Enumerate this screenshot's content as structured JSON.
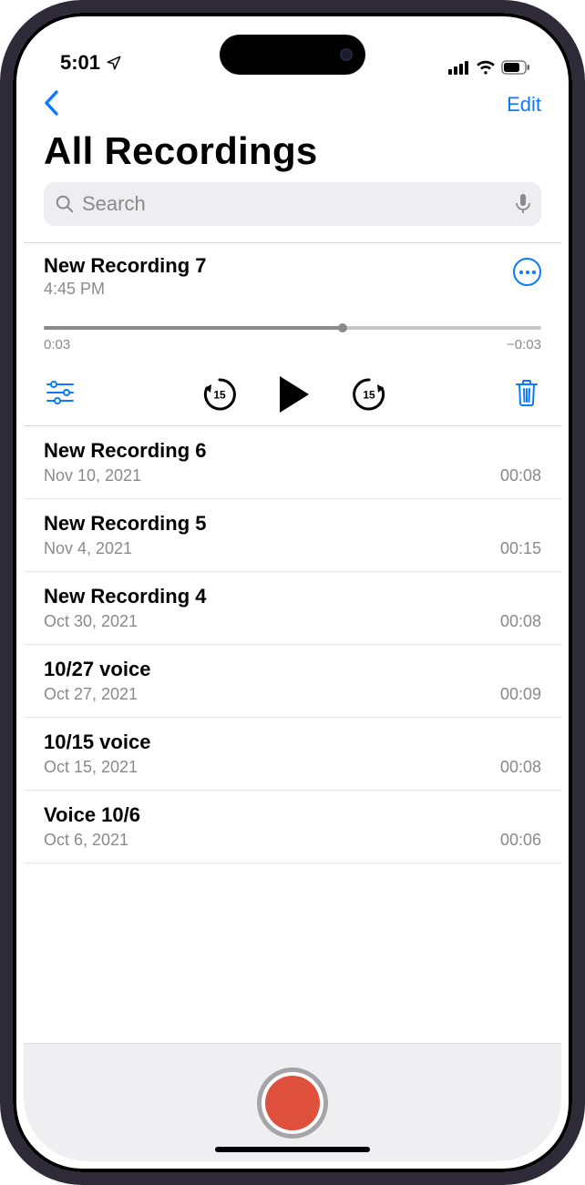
{
  "statusbar": {
    "time": "5:01"
  },
  "nav": {
    "edit_label": "Edit"
  },
  "page_title": "All Recordings",
  "search": {
    "placeholder": "Search"
  },
  "expanded": {
    "title": "New Recording 7",
    "subtitle": "4:45 PM",
    "elapsed": "0:03",
    "remaining": "−0:03",
    "skip_label": "15",
    "progress_pct": 60
  },
  "recordings": [
    {
      "title": "New Recording 6",
      "date": "Nov 10, 2021",
      "duration": "00:08"
    },
    {
      "title": "New Recording 5",
      "date": "Nov 4, 2021",
      "duration": "00:15"
    },
    {
      "title": "New Recording 4",
      "date": "Oct 30, 2021",
      "duration": "00:08"
    },
    {
      "title": "10/27 voice",
      "date": "Oct 27, 2021",
      "duration": "00:09"
    },
    {
      "title": "10/15 voice",
      "date": "Oct 15, 2021",
      "duration": "00:08"
    },
    {
      "title": "Voice 10/6",
      "date": "Oct 6, 2021",
      "duration": "00:06"
    }
  ]
}
